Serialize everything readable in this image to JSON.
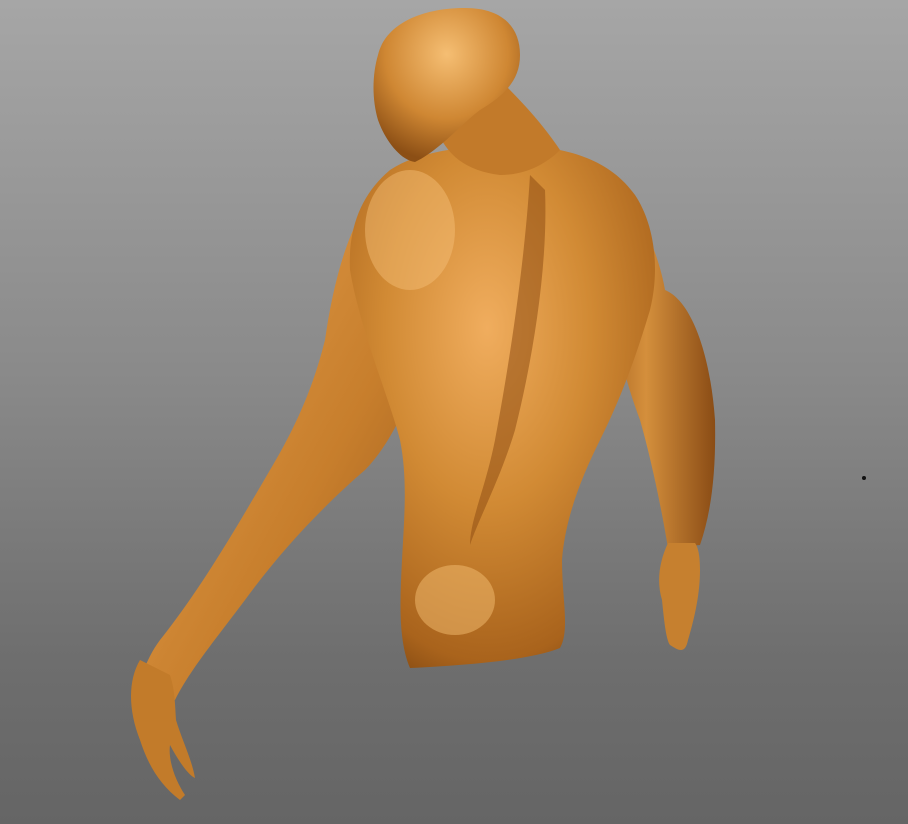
{
  "viewport": {
    "background_top": "#a6a6a6",
    "background_bottom": "#656565"
  },
  "model": {
    "subject": "sculpted-male-torso-back-view",
    "material_color": "#c9812a",
    "material_highlight": "#f2b264",
    "material_shadow": "#6e3d0c"
  }
}
